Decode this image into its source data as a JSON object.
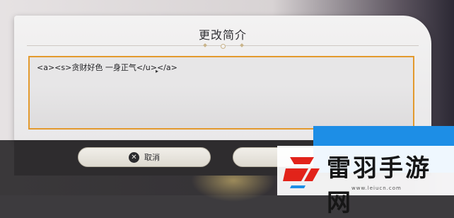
{
  "dialog": {
    "title": "更改简介",
    "textarea_value": "<a><s>贪财好色 一身正气</u></a>"
  },
  "buttons": {
    "cancel_label": "取消",
    "cancel_icon": "close-circle-icon",
    "confirm_label": ""
  },
  "watermark": {
    "brand": "雷羽手游网",
    "url": "www.leiucn.com"
  },
  "colors": {
    "textarea_border": "#e39a2e",
    "watermark_blue": "#1d8ee6",
    "logo_red": "#e2231a"
  }
}
